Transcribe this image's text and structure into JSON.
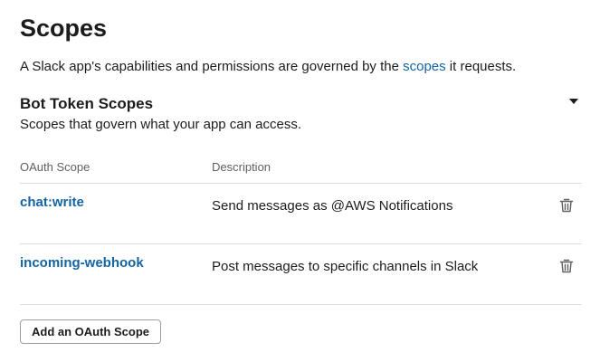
{
  "page": {
    "title": "Scopes",
    "intro_prefix": "A Slack app's capabilities and permissions are governed by the ",
    "intro_link": "scopes",
    "intro_suffix": " it requests."
  },
  "section": {
    "title": "Bot Token Scopes",
    "description": "Scopes that govern what your app can access."
  },
  "table": {
    "headers": {
      "scope": "OAuth Scope",
      "description": "Description"
    },
    "rows": [
      {
        "scope": "chat:write",
        "description": "Send messages as @AWS Notifications"
      },
      {
        "scope": "incoming-webhook",
        "description": "Post messages to specific channels in Slack"
      }
    ]
  },
  "actions": {
    "add_scope_label": "Add an OAuth Scope"
  },
  "colors": {
    "link": "#1264a3",
    "text": "#1d1c1d",
    "muted": "#616061",
    "divider": "#dddddd"
  }
}
